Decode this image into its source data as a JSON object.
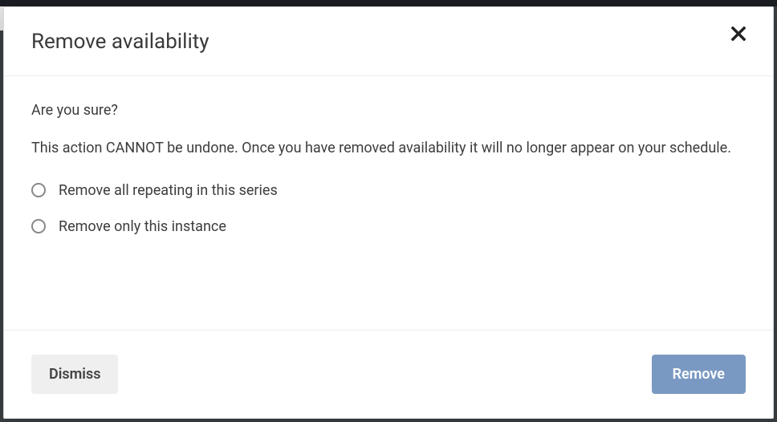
{
  "modal": {
    "title": "Remove availability",
    "question": "Are you sure?",
    "description": "This action CANNOT be undone. Once you have removed availability it will no longer appear on your schedule.",
    "options": {
      "series": "Remove all repeating in this series",
      "instance": "Remove only this instance"
    },
    "buttons": {
      "dismiss": "Dismiss",
      "remove": "Remove"
    }
  }
}
